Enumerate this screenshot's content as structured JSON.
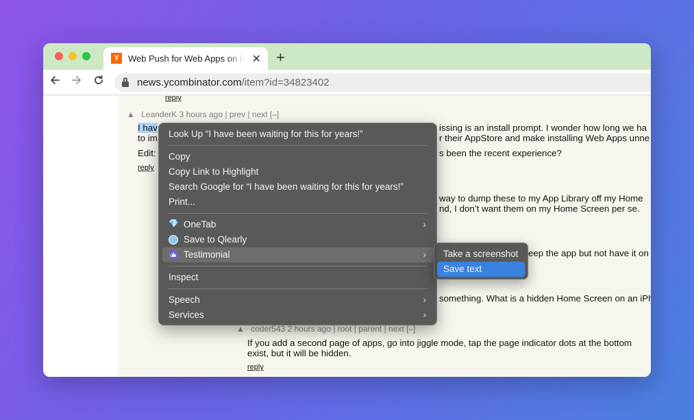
{
  "browser": {
    "tab_title": "Web Push for Web Apps on iOS",
    "favicon_letter": "Y",
    "new_tab_label": "+",
    "close_label": "✕",
    "url_host": "news.ycombinator.com",
    "url_path": "/item?id=34823402",
    "icons": [
      "back-arrow-icon",
      "forward-arrow-icon",
      "reload-icon",
      "lock-icon"
    ]
  },
  "page": {
    "top_reply": "reply",
    "comment1": {
      "meta": "LeanderK 3 hours ago | prev | next [–]",
      "selected_text": "I hav",
      "line1_right": "issing is an install prompt. I wonder how long we ha",
      "line2_left": "to im",
      "line2_right": "r their AppStore and make installing Web Apps unne",
      "edit_left": "Edit:",
      "edit_right": "s been the recent experience?",
      "reply": "reply"
    },
    "comment2": {
      "line1_right": "way to dump these to my App Library off my Home",
      "line2_right": "nd, I don’t want them on my Home Screen per se."
    },
    "comment3": {
      "line1_right": "eep the app but not have it on"
    },
    "comment4": {
      "line1_right": "something. What is a hidden Home Screen on an iPh"
    },
    "comment5": {
      "meta": "coder543 2 hours ago | root | parent | next [–]",
      "line1": "If you add a second page of apps, go into jiggle mode, tap the page indicator dots at the bottom",
      "line2": "exist, but it will be hidden.",
      "reply": "reply"
    },
    "vote_arrow": "▲"
  },
  "context_menu": {
    "look_up": "Look Up “I have been waiting for this for years!”",
    "copy": "Copy",
    "copy_link": "Copy Link to Highlight",
    "search_google": "Search Google for “I have been waiting for this for years!”",
    "print": "Print...",
    "onetab": "OneTab",
    "save_qlearly": "Save to Qlearly",
    "testimonial": "Testimonial",
    "inspect": "Inspect",
    "speech": "Speech",
    "services": "Services",
    "chevron": "›",
    "onetab_icon_glyph": "💎"
  },
  "submenu": {
    "take_screenshot": "Take a screenshot",
    "save_text": "Save text"
  },
  "colors": {
    "tabstrip": "#cde8c4",
    "hn_background": "#f6f6ef",
    "submenu_active": "#3a82e0",
    "selection": "#b3d4fc"
  }
}
